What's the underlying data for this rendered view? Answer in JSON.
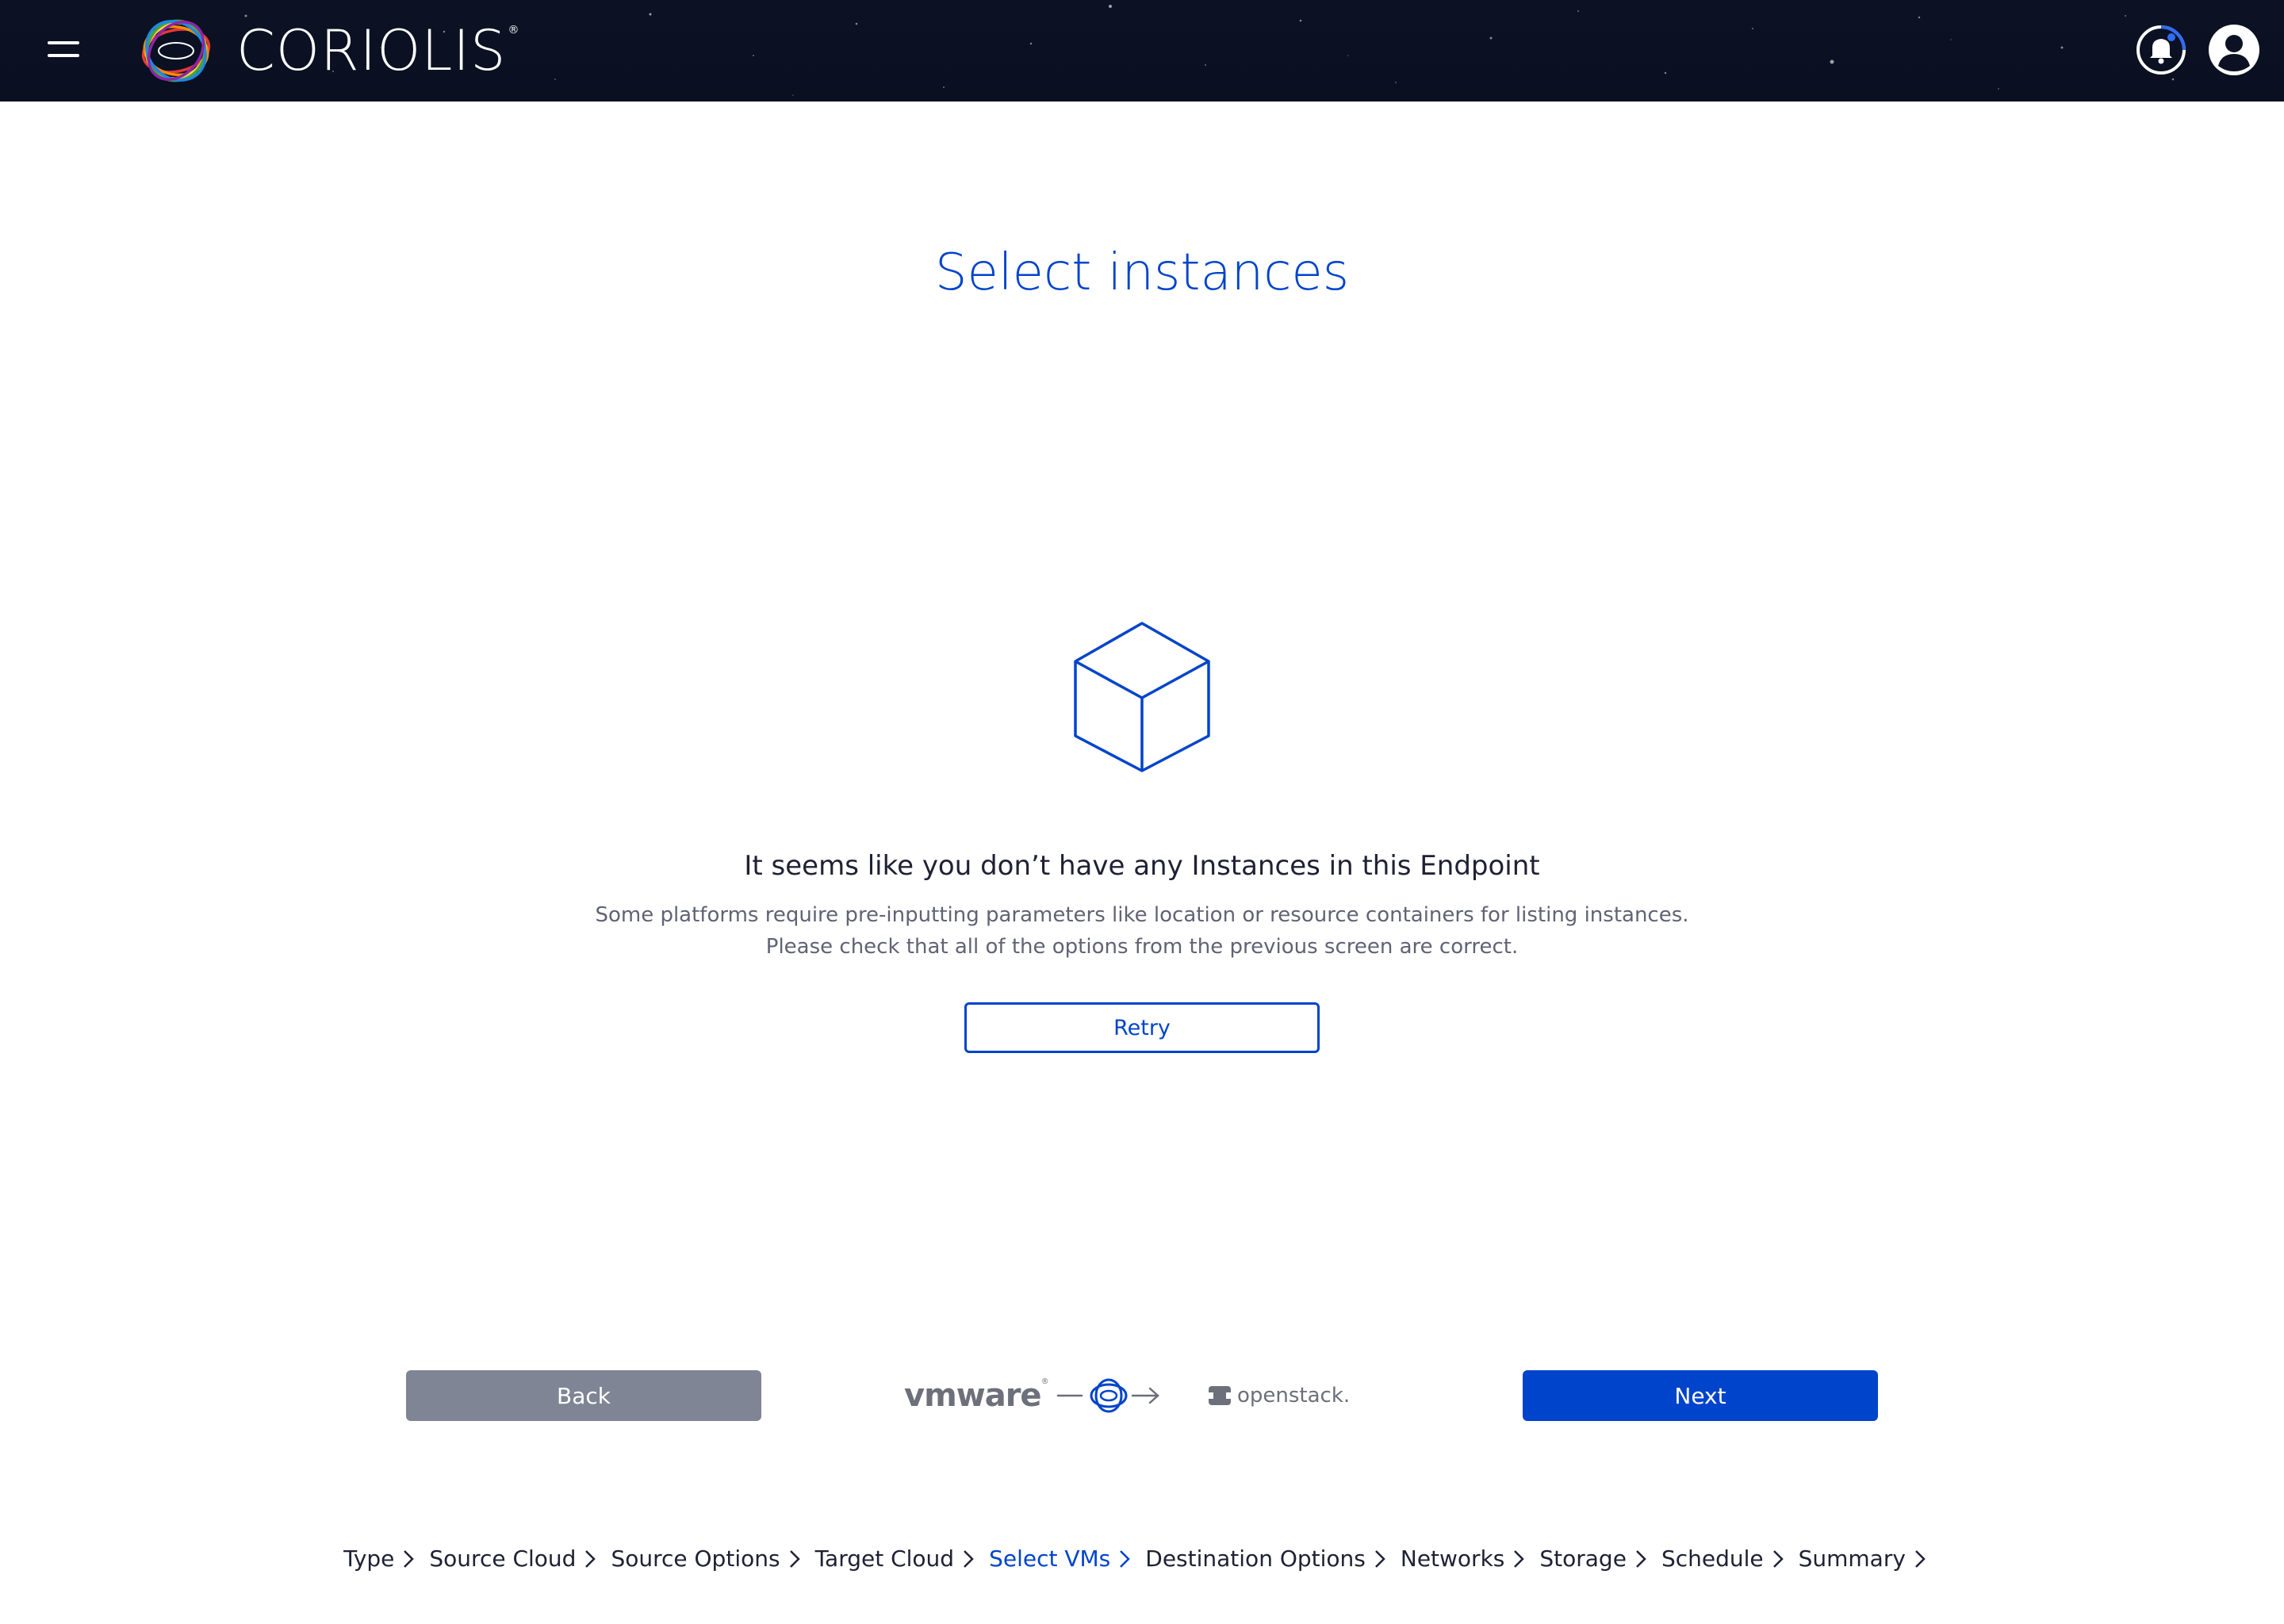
{
  "app": {
    "brand": "CORIOLIS",
    "brand_mark": "®"
  },
  "header": {
    "menu_icon": "hamburger-menu-icon",
    "notification_icon": "bell-icon",
    "user_icon": "user-avatar-icon"
  },
  "page": {
    "title": "Select instances"
  },
  "empty_state": {
    "icon": "cube-icon",
    "heading": "It seems like you don’t have any Instances in this Endpoint",
    "description_line1": "Some platforms require pre-inputting parameters like location or resource containers for listing instances.",
    "description_line2": "Please check that all of the options from the previous screen are correct.",
    "retry_label": "Retry"
  },
  "footer": {
    "back_label": "Back",
    "next_label": "Next",
    "source_logo": "vmware",
    "source_logo_mark": "®",
    "target_logo": "openstack.",
    "flow_icon": "coriolis-migration-arrow-icon"
  },
  "steps": [
    {
      "label": "Type",
      "active": false
    },
    {
      "label": "Source Cloud",
      "active": false
    },
    {
      "label": "Source Options",
      "active": false
    },
    {
      "label": "Target Cloud",
      "active": false
    },
    {
      "label": "Select VMs",
      "active": true
    },
    {
      "label": "Destination Options",
      "active": false
    },
    {
      "label": "Networks",
      "active": false
    },
    {
      "label": "Storage",
      "active": false
    },
    {
      "label": "Schedule",
      "active": false
    },
    {
      "label": "Summary",
      "active": false
    }
  ],
  "colors": {
    "accent": "#0044cb",
    "back_button": "#7f8595",
    "header_bg": "#0c1224",
    "text_primary": "#202134",
    "text_secondary": "#616374"
  }
}
